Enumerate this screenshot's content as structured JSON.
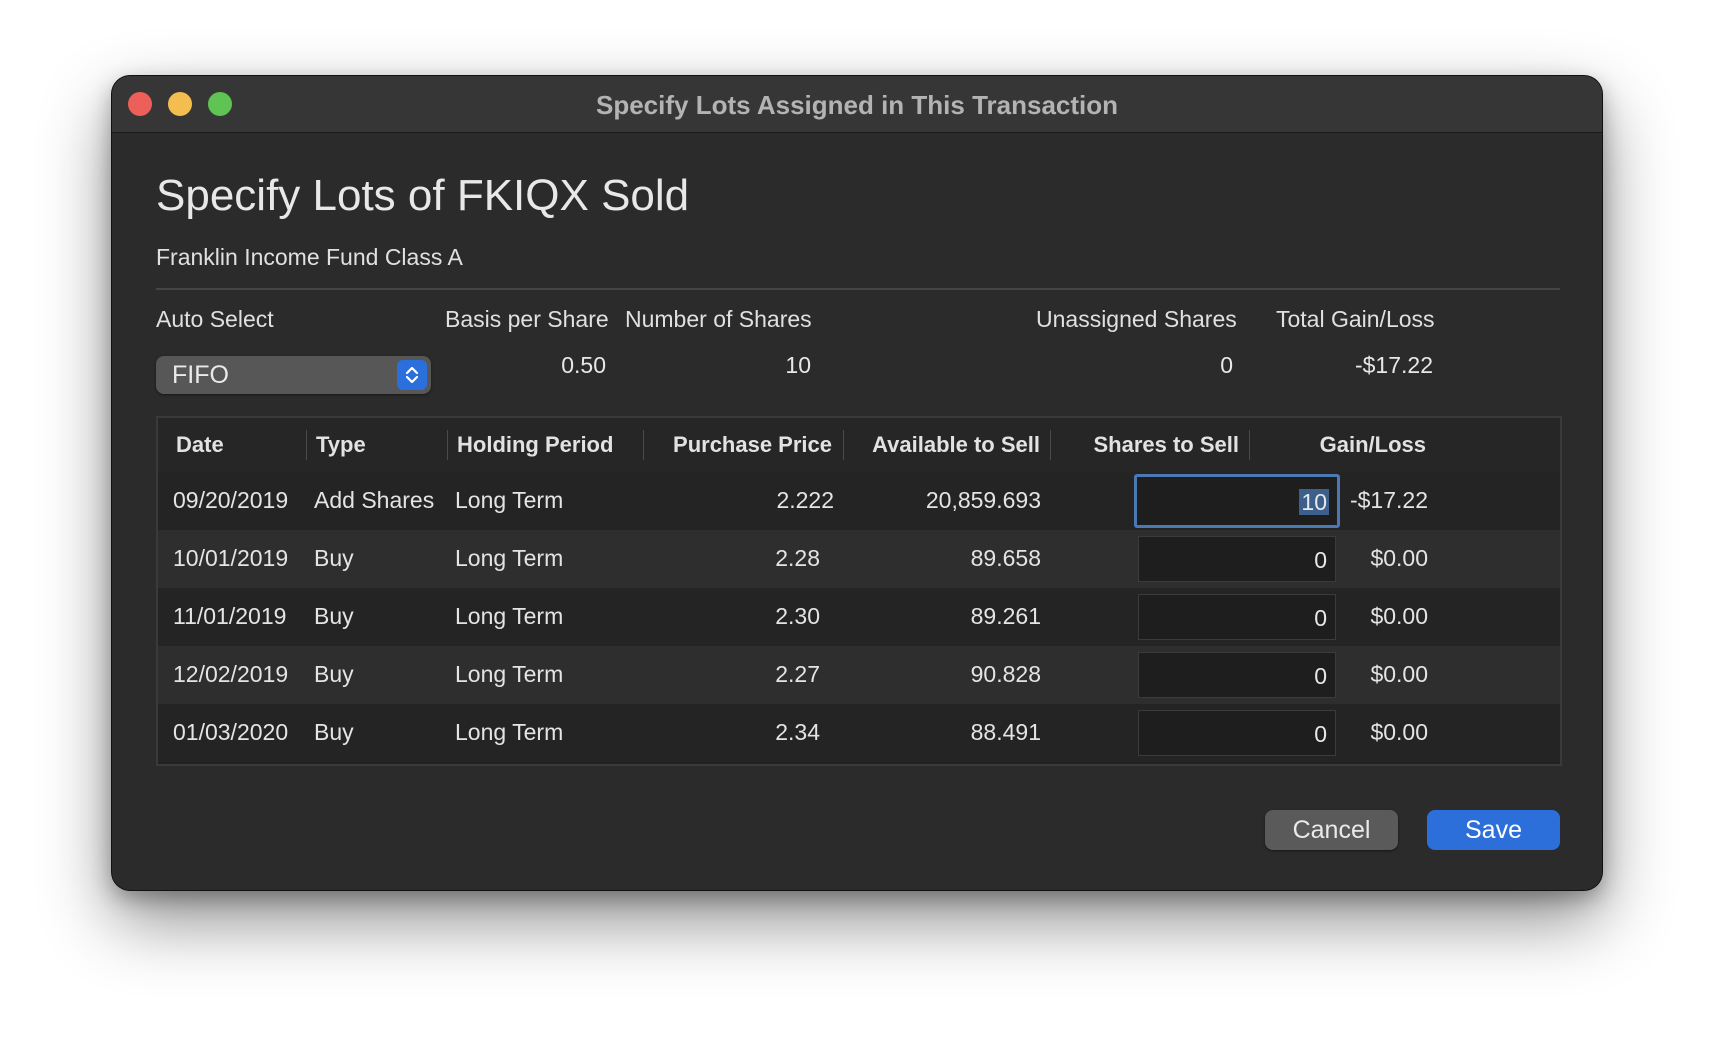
{
  "window": {
    "title": "Specify Lots Assigned in This Transaction"
  },
  "header": {
    "title": "Specify Lots of FKIQX Sold",
    "subtitle": "Franklin Income Fund Class A"
  },
  "summary": {
    "auto_select_label": "Auto Select",
    "auto_select_value": "FIFO",
    "basis_label": "Basis per Share",
    "basis_value": "0.50",
    "shares_label": "Number of Shares",
    "shares_value": "10",
    "unassigned_label": "Unassigned Shares",
    "unassigned_value": "0",
    "gain_label": "Total Gain/Loss",
    "gain_value": "-$17.22"
  },
  "table": {
    "columns": [
      "Date",
      "Type",
      "Holding Period",
      "Purchase Price",
      "Available to Sell",
      "Shares to Sell",
      "Gain/Loss"
    ],
    "rows": [
      {
        "date": "09/20/2019",
        "type": "Add Shares",
        "period": "Long Term",
        "price": "2.222",
        "available": "20,859.693",
        "shares": "10",
        "gain": "-$17.22"
      },
      {
        "date": "10/01/2019",
        "type": "Buy",
        "period": "Long Term",
        "price": "2.28",
        "available": "89.658",
        "shares": "0",
        "gain": "$0.00"
      },
      {
        "date": "11/01/2019",
        "type": "Buy",
        "period": "Long Term",
        "price": "2.30",
        "available": "89.261",
        "shares": "0",
        "gain": "$0.00"
      },
      {
        "date": "12/02/2019",
        "type": "Buy",
        "period": "Long Term",
        "price": "2.27",
        "available": "90.828",
        "shares": "0",
        "gain": "$0.00"
      },
      {
        "date": "01/03/2020",
        "type": "Buy",
        "period": "Long Term",
        "price": "2.34",
        "available": "88.491",
        "shares": "0",
        "gain": "$0.00"
      }
    ]
  },
  "buttons": {
    "cancel": "Cancel",
    "save": "Save"
  },
  "colors": {
    "accent": "#2c6fdb",
    "window_bg": "#2b2b2b",
    "close": "#ed5f59",
    "minimize": "#f4bd4f",
    "zoom": "#5fc453"
  }
}
